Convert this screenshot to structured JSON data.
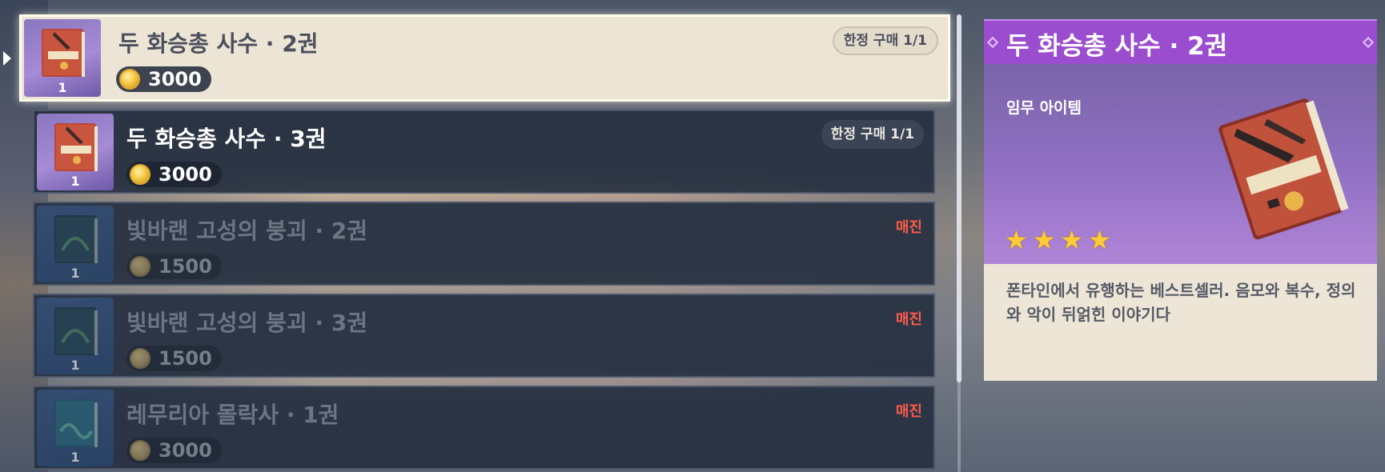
{
  "shop_items": [
    {
      "title": "두 화승총 사수 · 2권",
      "price": "3000",
      "quantity": "1",
      "status": "한정 구매 1/1",
      "selected": true,
      "available": true
    },
    {
      "title": "두 화승총 사수 · 3권",
      "price": "3000",
      "quantity": "1",
      "status": "한정 구매 1/1",
      "selected": false,
      "available": true
    },
    {
      "title": "빛바랜 고성의 붕괴 · 2권",
      "price": "1500",
      "quantity": "1",
      "status": "매진",
      "selected": false,
      "available": false
    },
    {
      "title": "빛바랜 고성의 붕괴 · 3권",
      "price": "1500",
      "quantity": "1",
      "status": "매진",
      "selected": false,
      "available": false
    },
    {
      "title": "레무리아 몰락사 · 1권",
      "price": "3000",
      "quantity": "1",
      "status": "매진",
      "selected": false,
      "available": false
    }
  ],
  "detail": {
    "title": "두 화승총 사수 · 2권",
    "item_type": "임무 아이템",
    "rarity_stars": 4,
    "description": "폰타인에서 유행하는 베스트셀러. 음모와 복수, 정의와 악이 뒤얽힌 이야기다"
  },
  "colors": {
    "header_purple": "#9b4dcf",
    "star_gold": "#ffcc33",
    "sold_out_red": "#ff5a4a",
    "selected_row_bg": "#ece5d6",
    "row_bg": "#263040"
  },
  "icons": {
    "currency": "gold-coin-icon",
    "selector": "triangle-right-icon",
    "rarity": "star-icon"
  }
}
